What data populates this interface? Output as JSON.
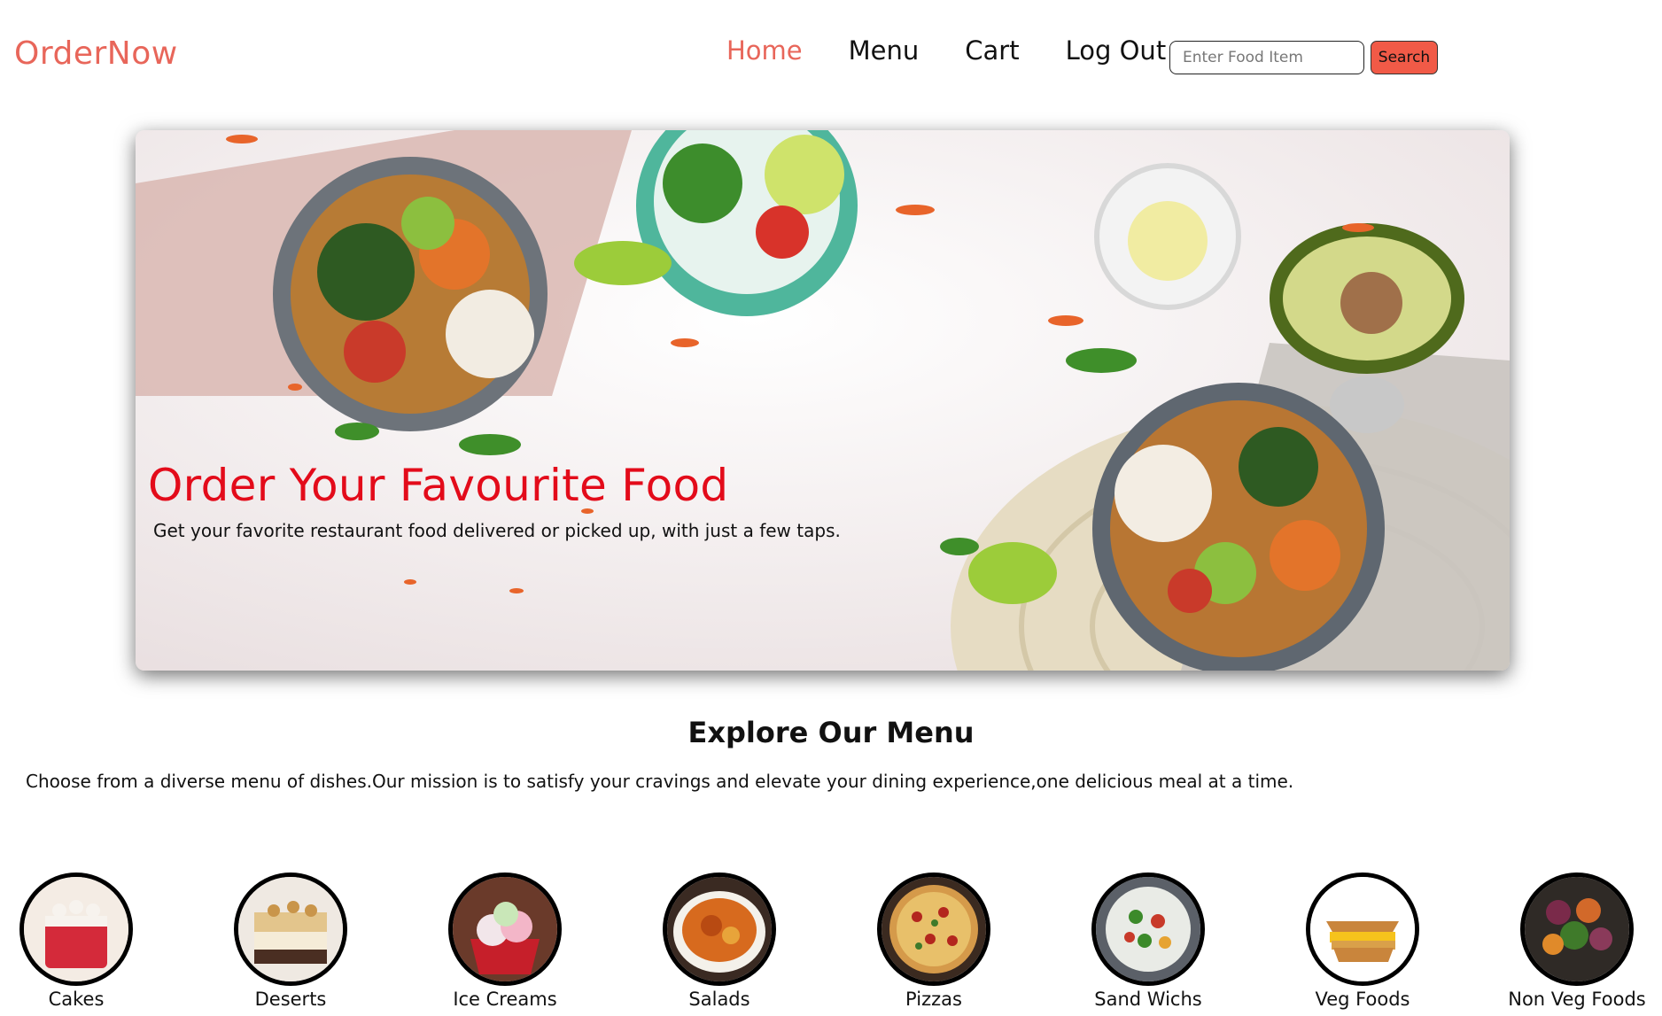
{
  "brand": "OrderNow",
  "nav": {
    "home": "Home",
    "menu": "Menu",
    "cart": "Cart",
    "logout": "Log Out"
  },
  "search": {
    "placeholder": "Enter Food Item",
    "button": "Search"
  },
  "hero": {
    "title": "Order Your Favourite Food",
    "subtitle": "Get your favorite restaurant food delivered or picked up, with just a few taps."
  },
  "explore": {
    "title": "Explore Our Menu",
    "text": "Choose from a diverse menu of dishes.Our mission is to satisfy your cravings and elevate your dining experience,one delicious meal at a time."
  },
  "categories": [
    {
      "label": "Cakes",
      "icon": "cake-image"
    },
    {
      "label": "Deserts",
      "icon": "dessert-image"
    },
    {
      "label": "Ice Creams",
      "icon": "ice-cream-image"
    },
    {
      "label": "Salads",
      "icon": "salad-image"
    },
    {
      "label": "Pizzas",
      "icon": "pizza-image"
    },
    {
      "label": "Sand Wichs",
      "icon": "sandwich-image"
    },
    {
      "label": "Veg Foods",
      "icon": "veg-food-image"
    },
    {
      "label": "Non Veg Foods",
      "icon": "non-veg-food-image"
    }
  ],
  "colors": {
    "accent": "#e8665a",
    "hero_title": "#e30b1a",
    "search_button": "#f15a47"
  }
}
